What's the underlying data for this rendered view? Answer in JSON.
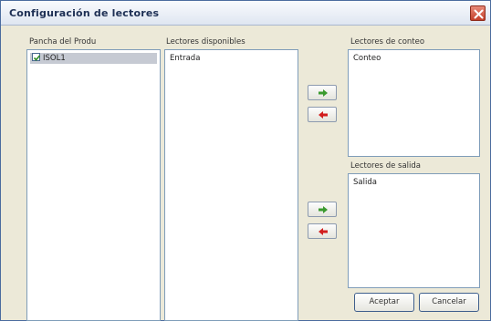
{
  "window": {
    "title": "Configuración de lectores"
  },
  "panels": {
    "left_label": "Pancha del Produ",
    "left_items": [
      {
        "label": "ISOL1",
        "checked": true,
        "selected": true
      }
    ],
    "middle_label": "Lectores disponibles",
    "middle_items": [
      "Entrada"
    ],
    "top_right_label": "Lectores de conteo",
    "top_right_items": [
      "Conteo"
    ],
    "bottom_right_label": "Lectores de salida",
    "bottom_right_items": [
      "Salida"
    ]
  },
  "arrows": {
    "add_icon_color": "#3a9a2e",
    "remove_icon_color": "#d21e1e"
  },
  "buttons": {
    "accept": "Aceptar",
    "cancel": "Cancelar"
  }
}
